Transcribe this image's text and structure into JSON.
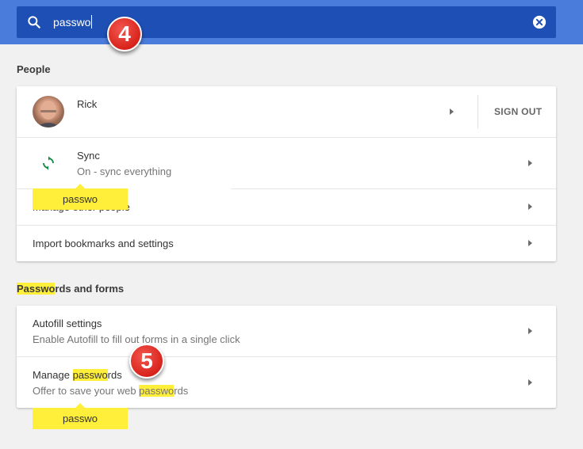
{
  "search": {
    "value": "passwo",
    "clear_label": "clear-icon"
  },
  "steps": [
    "4",
    "5"
  ],
  "people": {
    "title": "People",
    "profile": {
      "name": "Rick",
      "sign_out": "SIGN OUT"
    },
    "sync": {
      "title": "Sync",
      "subtitle": "On - sync everything"
    },
    "manage_people": {
      "title": "Manage other people"
    },
    "import": {
      "title": "Import bookmarks and settings"
    }
  },
  "passwords_forms": {
    "title_hl": "Passwo",
    "title_rest": "rds and forms",
    "autofill": {
      "title": "Autofill settings",
      "subtitle": "Enable Autofill to fill out forms in a single click"
    },
    "manage_passwords": {
      "title_pre": "Manage ",
      "title_hl": "passwo",
      "title_post": "rds",
      "sub_pre": "Offer to save your web ",
      "sub_hl": "passwo",
      "sub_post": "rds"
    }
  },
  "tooltips": [
    "passwo",
    "passwo"
  ],
  "colors": {
    "topbar": "#4a7cdb",
    "searchbox": "#1e4fb5",
    "highlight": "#ffef3a",
    "step_badge": "#d8231b"
  }
}
